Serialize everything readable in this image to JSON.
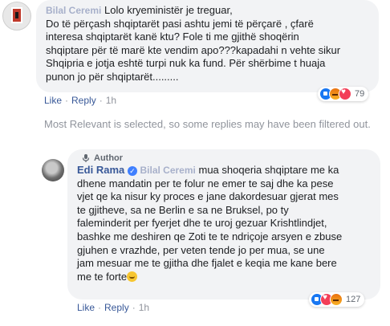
{
  "comment": {
    "author_name": "Bilal Ceremi",
    "text": "Lolo kryeministër je treguar,\nDo të përçash shqiptarët pasi ashtu jemi të përçarë , çfarë\ninteresa shqiptarët kanë ktu? Fole ti me gjithë shoqërin\nshqiptare për të marë kte vendim apo???kapadahi n vehte sikur\nShqipria e jotja eshtë turpi nuk ka fund. Për shërbime t huaja\npunon jo për shqiptarët.........",
    "actions": {
      "like": "Like",
      "reply": "Reply",
      "time": "1h"
    },
    "reactions": {
      "types": [
        "like-icon",
        "angry-icon",
        "heart-icon"
      ],
      "count": "79"
    }
  },
  "filter_note": "Most Relevant is selected, so some replies may have been filtered out.",
  "reply": {
    "author_badge": "Author",
    "author_name": "Edi Rama",
    "mention": "Bilal Ceremi",
    "text": "mua shoqeria shqiptare me ka\ndhene mandatin per te folur ne emer te saj dhe ka pese\nvjet qe ka nisur ky proces e jane dakordesuar gjerat mes\nte gjitheve, sa ne Berlin e sa ne Bruksel, po ty\nfaleminderit per fyerjet dhe te uroj gezuar Krishtlindjet,\nbashke me deshiren qe Zoti te te ndriçoje arsyen e zbuse\ngjuhen e vrazhde, per veten tende jo per mua, se une\njam mesuar me te gjitha dhe fjalet e keqia me kane bere\nme te forte",
    "actions": {
      "like": "Like",
      "reply": "Reply",
      "time": "1h"
    },
    "reactions": {
      "types": [
        "like-icon",
        "heart-icon",
        "angry-icon"
      ],
      "count": "127"
    }
  },
  "colors": {
    "link": "#385898",
    "bubble": "#f2f3f5",
    "meta": "#90949c",
    "redaction": "#2d4fd6"
  }
}
